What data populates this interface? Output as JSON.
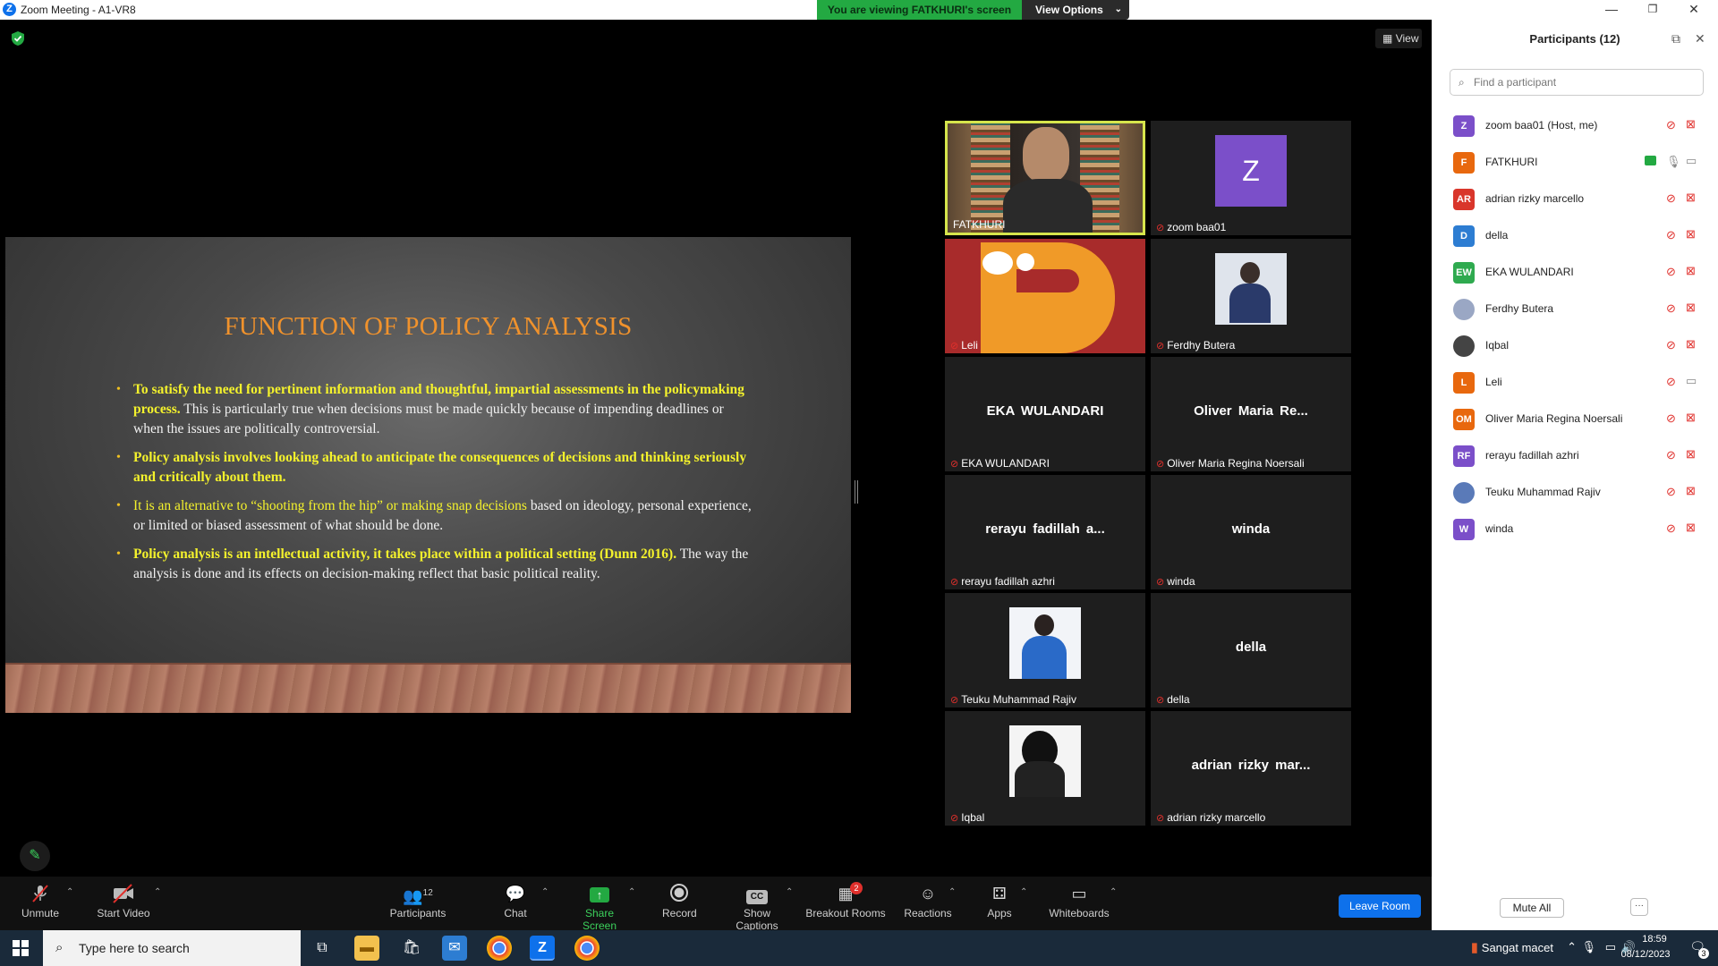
{
  "window": {
    "title": "Zoom Meeting - A1-VR8",
    "minimize": "—",
    "restore": "❐",
    "close": "✕"
  },
  "banner": {
    "viewing": "You are viewing FATKHURI's screen",
    "view_options": "View Options"
  },
  "top_right_view_label": "View",
  "slide": {
    "title": "FUNCTION OF POLICY ANALYSIS",
    "bullets": [
      {
        "parts": [
          {
            "text": "To satisfy the need for pertinent information and thoughtful, impartial assessments in the policymaking process.",
            "style": "yb"
          },
          {
            "text": " This is particularly true when decisions must be made quickly because of impending deadlines or when the issues are politically controversial.",
            "style": "w"
          }
        ]
      },
      {
        "parts": [
          {
            "text": "Policy analysis involves looking ahead to anticipate the consequences of decisions and thinking seriously and critically about them.",
            "style": "yb"
          }
        ]
      },
      {
        "parts": [
          {
            "text": "It is an alternative to “shooting from the hip” or making snap decisions",
            "style": "y"
          },
          {
            "text": " based on ideology, personal experience, or limited or biased assessment of what should be done.",
            "style": "w"
          }
        ]
      },
      {
        "parts": [
          {
            "text": "Policy analysis is an intellectual activity, it takes place within a political setting (Dunn 2016).",
            "style": "yb"
          },
          {
            "text": " The way the analysis is done and its effects on decision-making reflect that basic political reality.",
            "style": "w"
          }
        ]
      }
    ]
  },
  "gallery": [
    {
      "name": "FATKHURI",
      "kind": "video",
      "active": true,
      "muted": false
    },
    {
      "name": "zoom baa01",
      "kind": "letter",
      "letter": "Z",
      "color": "#7b4fc9",
      "muted": true
    },
    {
      "name": "Leli",
      "kind": "logo",
      "muted": true
    },
    {
      "name": "Ferdhy Butera",
      "kind": "photo",
      "muted": true
    },
    {
      "name": "EKA WULANDARI",
      "kind": "text",
      "big": "EKA WULANDARI",
      "muted": true
    },
    {
      "name": "Oliver Maria Regina Noersali",
      "kind": "text",
      "big": "Oliver Maria Re...",
      "muted": true
    },
    {
      "name": "rerayu fadillah azhri",
      "kind": "text",
      "big": "rerayu fadillah a...",
      "muted": true
    },
    {
      "name": "winda",
      "kind": "text",
      "big": "winda",
      "muted": true
    },
    {
      "name": "Teuku Muhammad Rajiv",
      "kind": "photo-blue",
      "muted": true
    },
    {
      "name": "della",
      "kind": "text",
      "big": "della",
      "muted": true
    },
    {
      "name": "Iqbal",
      "kind": "photo-bw",
      "muted": true
    },
    {
      "name": "adrian rizky marcello",
      "kind": "text",
      "big": "adrian rizky mar...",
      "muted": true
    }
  ],
  "toolbar": {
    "unmute": "Unmute",
    "start_video": "Start Video",
    "participants": "Participants",
    "participants_count": "12",
    "chat": "Chat",
    "share_screen": "Share Screen",
    "record": "Record",
    "show_captions": "Show Captions",
    "breakout_rooms": "Breakout Rooms",
    "breakout_badge": "2",
    "reactions": "Reactions",
    "apps": "Apps",
    "whiteboards": "Whiteboards",
    "leave": "Leave Room",
    "captions_icon": "CC"
  },
  "panel": {
    "title": "Participants (12)",
    "search_placeholder": "Find a participant",
    "mute_all": "Mute All",
    "more": "···",
    "participants": [
      {
        "initials": "Z",
        "color": "#7b4fc9",
        "name": "zoom baa01 (Host, me)",
        "mic": "muted",
        "cam": "off"
      },
      {
        "initials": "F",
        "color": "#e8680e",
        "name": "FATKHURI",
        "mic": "on",
        "cam": "on",
        "sharing": true
      },
      {
        "initials": "AR",
        "color": "#d9362b",
        "name": "adrian rizky marcello",
        "mic": "muted",
        "cam": "off"
      },
      {
        "initials": "D",
        "color": "#2d7dd2",
        "name": "della",
        "mic": "muted",
        "cam": "off"
      },
      {
        "initials": "EW",
        "color": "#2faa4f",
        "name": "EKA WULANDARI",
        "mic": "muted",
        "cam": "off"
      },
      {
        "initials": "",
        "color": "#9aa7c4",
        "name": "Ferdhy Butera",
        "mic": "muted",
        "cam": "off",
        "photo": true
      },
      {
        "initials": "",
        "color": "#444444",
        "name": "Iqbal",
        "mic": "muted",
        "cam": "off",
        "photo": true
      },
      {
        "initials": "L",
        "color": "#e8680e",
        "name": "Leli",
        "mic": "muted",
        "cam": "on-gray"
      },
      {
        "initials": "OM",
        "color": "#e8680e",
        "name": "Oliver Maria Regina Noersali",
        "mic": "muted",
        "cam": "off"
      },
      {
        "initials": "RF",
        "color": "#7b4fc9",
        "name": "rerayu fadillah azhri",
        "mic": "muted",
        "cam": "off"
      },
      {
        "initials": "",
        "color": "#5a7ab8",
        "name": "Teuku Muhammad Rajiv",
        "mic": "muted",
        "cam": "off",
        "photo": true
      },
      {
        "initials": "W",
        "color": "#7b4fc9",
        "name": "winda",
        "mic": "muted",
        "cam": "off"
      }
    ]
  },
  "taskbar": {
    "search_placeholder": "Type here to search",
    "weather": "Sangat macet",
    "time": "18:59",
    "date": "08/12/2023",
    "notif_count": "3"
  }
}
